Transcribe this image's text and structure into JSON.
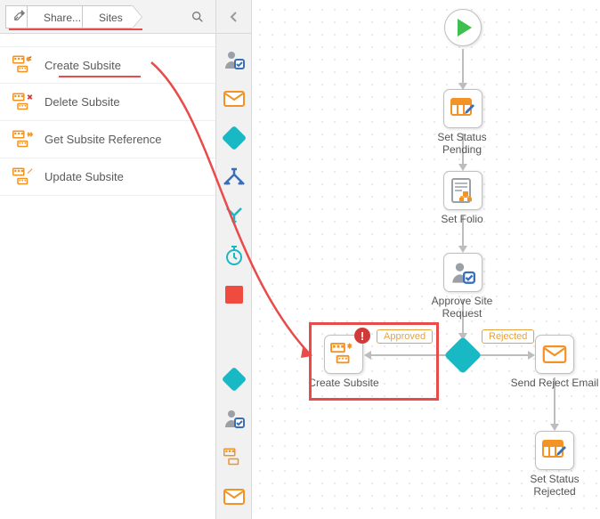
{
  "breadcrumb": {
    "root_icon": "tools",
    "items": [
      "Share...",
      "Sites"
    ]
  },
  "actions": [
    {
      "label": "Create Subsite",
      "icon": "create"
    },
    {
      "label": "Delete Subsite",
      "icon": "delete"
    },
    {
      "label": "Get Subsite Reference",
      "icon": "reference"
    },
    {
      "label": "Update Subsite",
      "icon": "update"
    }
  ],
  "toolbar_icons": [
    "user-task",
    "email",
    "decision",
    "split",
    "merge",
    "timer",
    "placeholder"
  ],
  "toolbar_icons_bottom": [
    "decision",
    "user-task",
    "site",
    "email"
  ],
  "workflow": {
    "start": "Start",
    "nodes": {
      "set_status_pending": "Set Status Pending",
      "set_folio": "Set Folio",
      "approve_site_request": "Approve Site\nRequest",
      "create_subsite": "Create Subsite",
      "send_reject_email": "Send Reject Email",
      "set_status_rejected": "Set Status Rejected"
    },
    "edges": {
      "approved": "Approved",
      "rejected": "Rejected"
    },
    "error_badge": "!"
  },
  "colors": {
    "accent_teal": "#18b9c4",
    "accent_orange": "#f39325",
    "annotation_red": "#e94b4b"
  }
}
